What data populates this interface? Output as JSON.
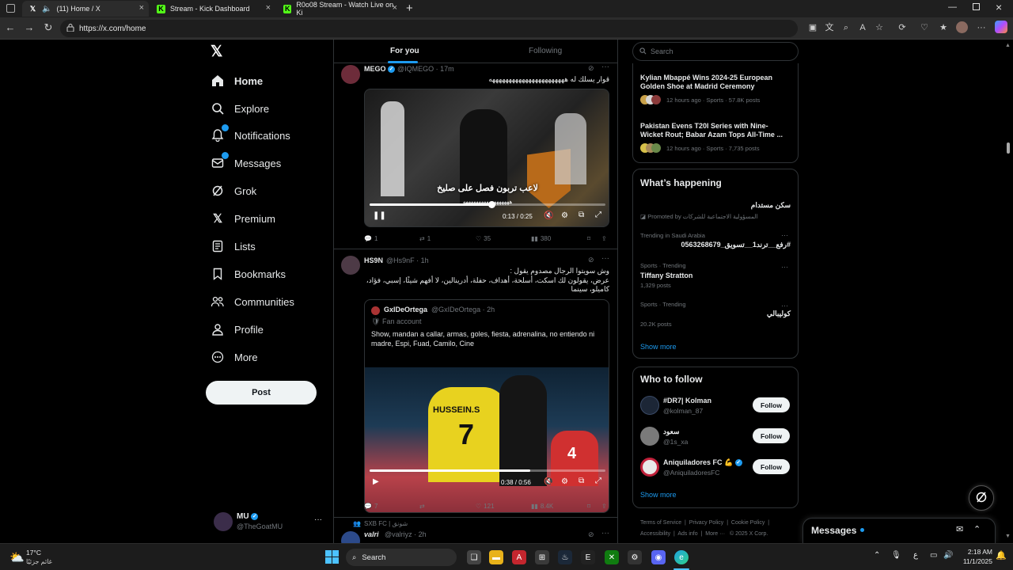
{
  "browser": {
    "tabs": [
      {
        "title": "(11) Home / X",
        "icon": "x-icon",
        "active": true
      },
      {
        "title": "Stream - Kick Dashboard",
        "icon": "kick-icon",
        "active": false
      },
      {
        "title": "R0o08 Stream - Watch Live on Ki",
        "icon": "kick-icon",
        "active": false
      }
    ],
    "new_tab": "+",
    "url": "https://x.com/home"
  },
  "nav": {
    "items": [
      {
        "label": "Home",
        "icon": "home-icon"
      },
      {
        "label": "Explore",
        "icon": "search-icon"
      },
      {
        "label": "Notifications",
        "icon": "bell-icon"
      },
      {
        "label": "Messages",
        "icon": "mail-icon"
      },
      {
        "label": "Grok",
        "icon": "grok-icon"
      },
      {
        "label": "Premium",
        "icon": "x-icon"
      },
      {
        "label": "Lists",
        "icon": "list-icon"
      },
      {
        "label": "Bookmarks",
        "icon": "bookmark-icon"
      },
      {
        "label": "Communities",
        "icon": "communities-icon"
      },
      {
        "label": "Profile",
        "icon": "person-icon"
      },
      {
        "label": "More",
        "icon": "more-icon"
      }
    ],
    "post_label": "Post",
    "account": {
      "name": "MU",
      "handle": "@TheGoatMU"
    }
  },
  "feed": {
    "tabs": [
      "For you",
      "Following"
    ],
    "tweet1": {
      "name": "MEGO",
      "handle": "@IQMEGO · 17m",
      "text": "قوار يسلك له هههههههههههههههههههههههه",
      "video": {
        "caption": "لاعب تربون فصل على صليخ",
        "overlay": "ههههههههههههههههههه",
        "time": "0:13 / 0:25",
        "progress": 0.52
      },
      "stats": {
        "replies": "1",
        "reposts": "1",
        "likes": "35",
        "views": "380"
      }
    },
    "tweet2": {
      "name": "HS9N",
      "handle": "@Hs9nF · 1h",
      "text": "وش سويتوا الرجال مصدوم يقول :\nعرض، يقولون لك اسكت، أسلحة، أهداف، حفلة، أدرينالين، لا أفهم شيئًا، إسبي، فؤاد، كاميلو، سينما",
      "quote": {
        "name": "GxIDeOrtega",
        "handle": "@GxIDeOrtega · 2h",
        "label": "Fan account",
        "text": "Show, mandan a callar, armas, goles, fiesta, adrenalina, no entiendo ni madre, Espi, Fuad, Camilo, Cine"
      },
      "video": {
        "jersey_name": "HUSSEIN.S",
        "jersey_number": "7",
        "other_number": "4",
        "time": "0:38 / 0:56",
        "progress": 0.68
      },
      "stats": {
        "replies": "7",
        "reposts": "",
        "likes": "121",
        "views": "8.4K"
      }
    },
    "tweet3": {
      "context": "SXB FC | شونق",
      "name": "valri",
      "handle": "@valriyz · 2h"
    }
  },
  "right": {
    "search_placeholder": "Search",
    "news": [
      {
        "title": "Kylian Mbappé Wins 2024-25 European Golden Shoe at Madrid Ceremony",
        "meta": "12 hours ago · Sports · 57.8K posts"
      },
      {
        "title": "Pakistan Evens T20I Series with Nine-Wicket Rout; Babar Azam Tops All-Time ...",
        "meta": "12 hours ago · Sports · 7,735 posts"
      }
    ],
    "happening": {
      "title": "What’s happening",
      "trends": [
        {
          "context": "",
          "title": "سكن مستدام",
          "meta": "Promoted by المسؤولية الاجتماعية للشركات"
        },
        {
          "context": "Trending in Saudi Arabia",
          "title": "#رفع__ترند1__تسويق_0563268679",
          "meta": ""
        },
        {
          "context": "Sports · Trending",
          "title": "Tiffany Stratton",
          "meta": "1,329 posts"
        },
        {
          "context": "Sports · Trending",
          "title": "كوليبالي",
          "meta": "20.2K posts"
        }
      ],
      "show_more": "Show more"
    },
    "who_to_follow": {
      "title": "Who to follow",
      "accounts": [
        {
          "name": "#DR7| Kolman",
          "handle": "@kolman_87"
        },
        {
          "name": "سعود",
          "handle": "@1s_xa"
        },
        {
          "name": "Aniquiladores FC 💪",
          "handle": "@AniquiladoresFC"
        }
      ],
      "follow_label": "Follow",
      "show_more": "Show more"
    },
    "footer": [
      "Terms of Service",
      "Privacy Policy",
      "Cookie Policy",
      "Accessibility",
      "Ads info",
      "More ···",
      "© 2025 X Corp."
    ],
    "messages_label": "Messages"
  },
  "taskbar": {
    "weather_temp": "17°C",
    "weather_desc": "غائم جزئيًا",
    "search_label": "Search",
    "lang": "ع",
    "time": "2:18 AM",
    "date": "11/1/2025"
  },
  "colors": {
    "accent": "#1d9bf0",
    "bg": "#000000",
    "border": "#2f3336",
    "muted": "#71767b"
  }
}
